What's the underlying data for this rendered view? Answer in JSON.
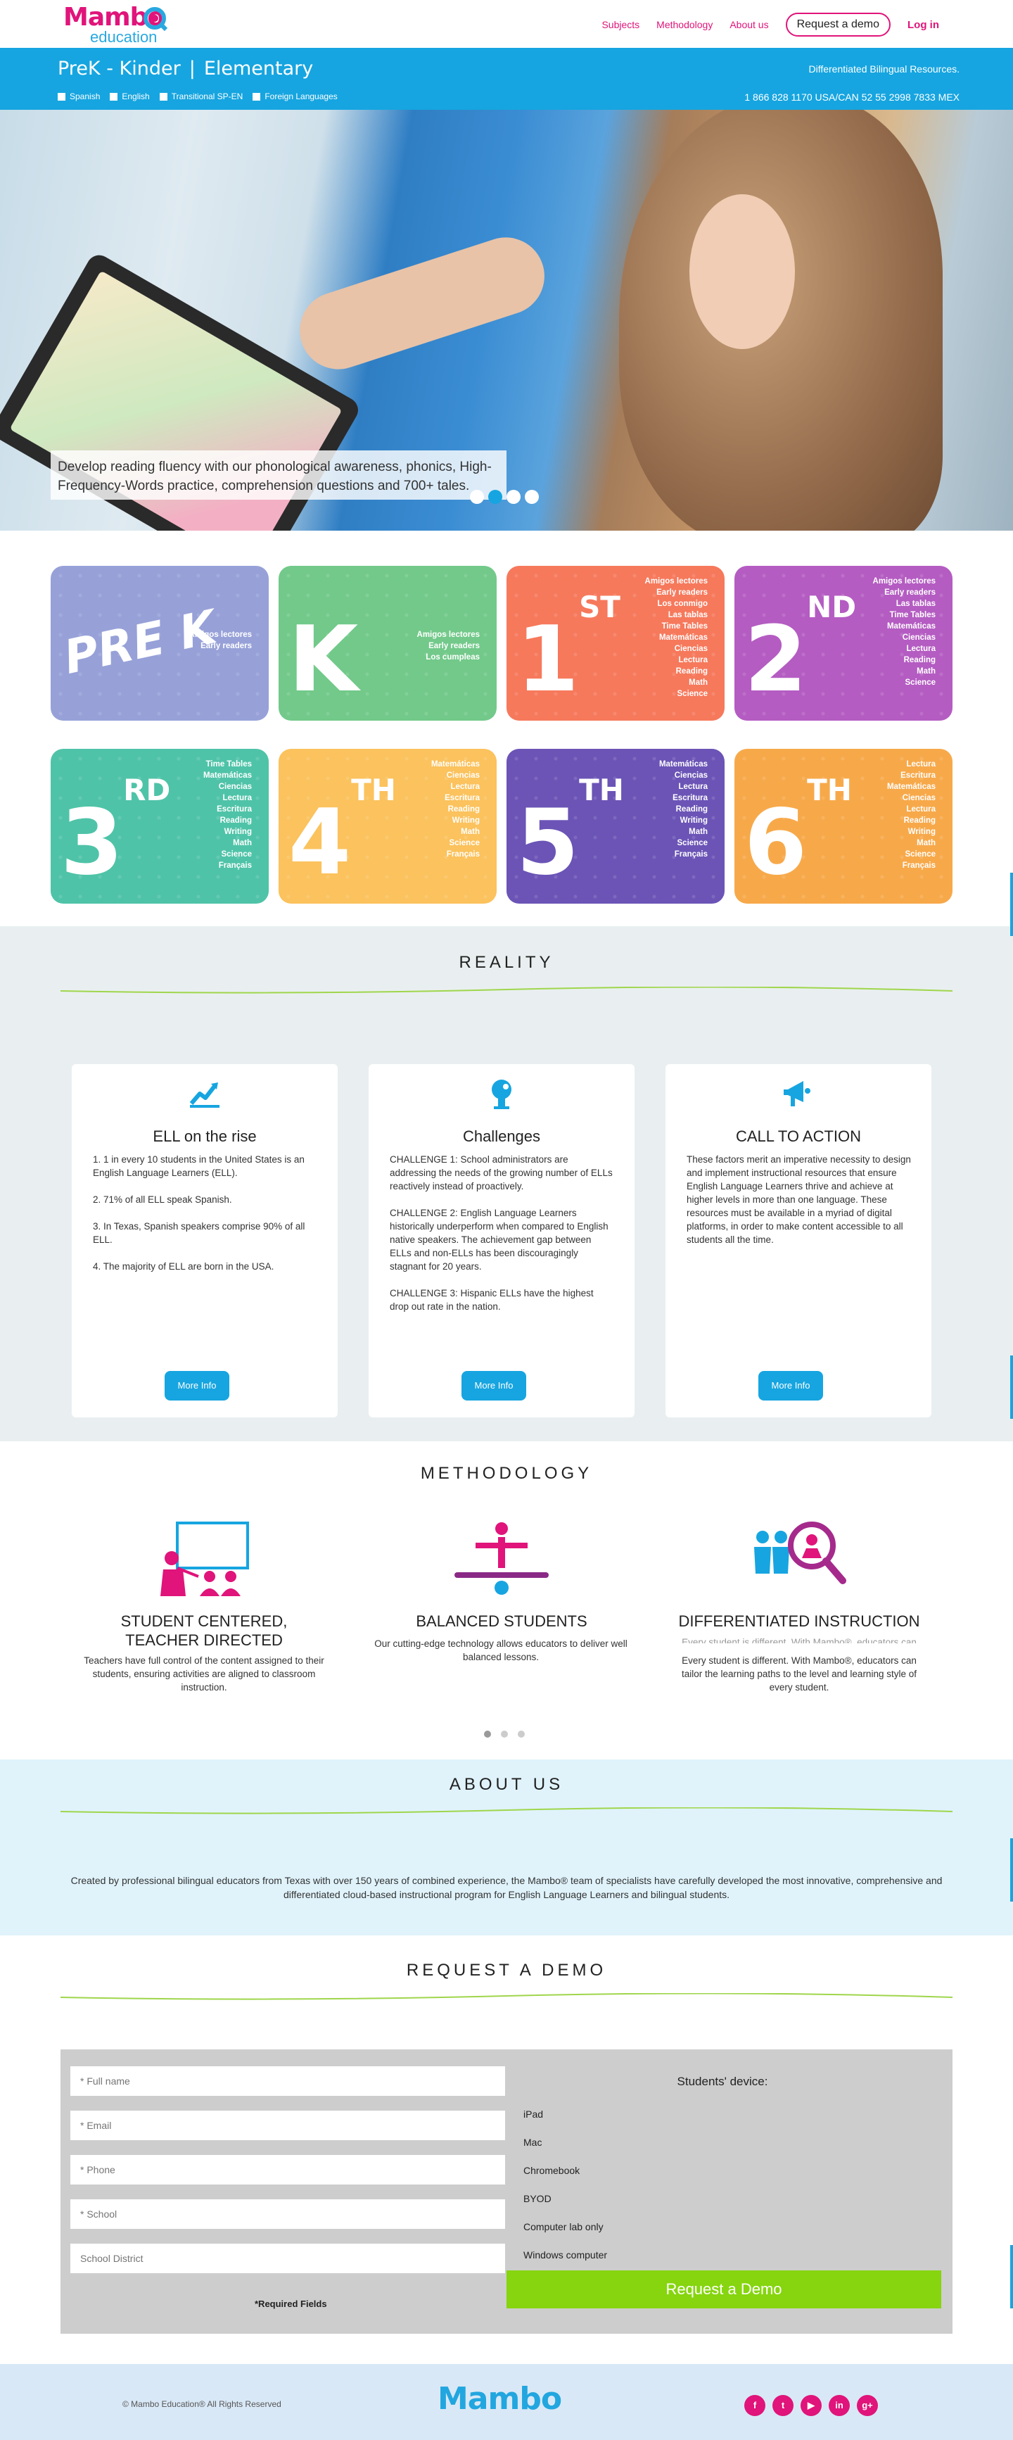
{
  "header": {
    "logo_word": "Mambo",
    "logo_sub": "education",
    "nav": [
      "Subjects",
      "Methodology",
      "About us"
    ],
    "request_demo": "Request a demo",
    "login": "Log in"
  },
  "bluebar": {
    "level_1": "PreK - Kinder",
    "separator": "|",
    "level_2": "Elementary",
    "languages": [
      "Spanish",
      "English",
      "Transitional SP-EN",
      "Foreign Languages"
    ],
    "tagline": "Differentiated Bilingual Resources.",
    "phones": "1 866 828 1170 USA/CAN    52 55 2998 7833 MEX"
  },
  "hero": {
    "caption": "Develop reading fluency with our phonological awareness, phonics, High-Frequency-Words practice, comprehension questions and 700+ tales.",
    "slides": 4,
    "active_slide": 1
  },
  "grades": [
    {
      "label": "PRE K",
      "sup": "",
      "color": "#97a1d8",
      "subjects": [
        "Amigos lectores",
        "Early readers"
      ]
    },
    {
      "label": "K",
      "sup": "",
      "color": "#72c98a",
      "subjects": [
        "Amigos lectores",
        "Early readers",
        "Los cumpleas"
      ]
    },
    {
      "label": "1",
      "sup": "ST",
      "color": "#f6795c",
      "subjects": [
        "Amigos lectores",
        "Early readers",
        "Los conmigo",
        "Las tablas",
        "Time Tables",
        "Matemáticas",
        "Ciencias",
        "Lectura",
        "Reading",
        "Math",
        "Science"
      ]
    },
    {
      "label": "2",
      "sup": "ND",
      "color": "#b45cc2",
      "subjects": [
        "Amigos lectores",
        "Early readers",
        "Las tablas",
        "Time Tables",
        "Matemáticas",
        "Ciencias",
        "Lectura",
        "Reading",
        "Math",
        "Science"
      ]
    },
    {
      "label": "3",
      "sup": "RD",
      "color": "#4fc3a8",
      "subjects": [
        "Time Tables",
        "Matemáticas",
        "Ciencias",
        "Lectura",
        "Escritura",
        "Reading",
        "Writing",
        "Math",
        "Science",
        "Français"
      ]
    },
    {
      "label": "4",
      "sup": "TH",
      "color": "#fbc25d",
      "subjects": [
        "Matemáticas",
        "Ciencias",
        "Lectura",
        "Escritura",
        "Reading",
        "Writing",
        "Math",
        "Science",
        "Français"
      ]
    },
    {
      "label": "5",
      "sup": "TH",
      "color": "#6b54b6",
      "subjects": [
        "Matemáticas",
        "Ciencias",
        "Lectura",
        "Escritura",
        "Reading",
        "Writing",
        "Math",
        "Science",
        "Français"
      ]
    },
    {
      "label": "6",
      "sup": "TH",
      "color": "#f7a94a",
      "subjects": [
        "Lectura",
        "Escritura",
        "Matemáticas",
        "Ciencias",
        "Lectura",
        "Reading",
        "Writing",
        "Math",
        "Science",
        "Français"
      ]
    }
  ],
  "reality": {
    "title": "REALITY",
    "cards": [
      {
        "icon": "chart-rise-icon",
        "title": "ELL on the rise",
        "paragraphs": [
          "1. 1 in every 10 students in the United States is an English Language Learners (ELL).",
          "2. 71% of all ELL speak Spanish.",
          "3. In Texas, Spanish speakers comprise 90% of all ELL.",
          "4. The majority of ELL are born in the USA."
        ],
        "button": "More Info"
      },
      {
        "icon": "thinking-head-icon",
        "title": "Challenges",
        "paragraphs": [
          "CHALLENGE 1: School administrators are addressing the needs of the growing number of ELLs reactively instead of proactively.",
          "CHALLENGE 2: English Language Learners historically underperform when compared to English native speakers. The achievement gap between ELLs and non-ELLs has been discouragingly stagnant for 20 years.",
          "CHALLENGE 3: Hispanic ELLs have the highest drop out rate in the nation."
        ],
        "button": "More Info"
      },
      {
        "icon": "megaphone-icon",
        "title": "CALL TO ACTION",
        "paragraphs": [
          "These factors merit an imperative necessity to design and implement instructional resources that ensure English Language Learners thrive and achieve at higher levels in more than one language. These resources must be available in a myriad of digital platforms, in order to make content accessible to all students all the time."
        ],
        "button": "More Info"
      }
    ]
  },
  "methodology": {
    "title": "METHODOLOGY",
    "items": [
      {
        "icon": "teacher-board-icon",
        "title": "STUDENT CENTERED, TEACHER DIRECTED",
        "text": "Teachers have full control of the content assigned to their students, ensuring activities are aligned to classroom instruction."
      },
      {
        "icon": "balance-icon",
        "title": "BALANCED STUDENTS",
        "text": "Our cutting-edge technology allows educators to deliver well balanced lessons."
      },
      {
        "icon": "magnifier-people-icon",
        "title": "DIFFERENTIATED INSTRUCTION",
        "text_ghost": "Every student is different. With Mambo®, educators can",
        "text": "Every student is different. With Mambo®, educators can tailor the learning paths to the level and learning style of every student."
      }
    ],
    "pages": 3,
    "active_page": 1
  },
  "about": {
    "title": "ABOUT US",
    "text": "Created by professional bilingual educators from Texas with over 150 years of combined experience, the Mambo® team of specialists have carefully developed the most innovative, comprehensive and differentiated cloud-based instructional program for English Language Learners and bilingual students."
  },
  "demo": {
    "title": "REQUEST A DEMO",
    "fields": [
      "* Full name",
      "* Email",
      "* Phone",
      "* School",
      "School District"
    ],
    "required_note": "*Required Fields",
    "devices_title": "Students' device:",
    "devices": [
      "iPad",
      "Mac",
      "Chromebook",
      "BYOD",
      "Computer lab only",
      "Windows computer"
    ],
    "submit": "Request a Demo"
  },
  "footer": {
    "copyright": "© Mambo Education® All Rights Reserved",
    "logo": "Mambo",
    "socials": [
      "f",
      "t",
      "▶",
      "in",
      "g+"
    ]
  },
  "colors": {
    "brand_pink": "#e0147a",
    "brand_blue": "#16a5e0",
    "green": "#86d50f"
  }
}
